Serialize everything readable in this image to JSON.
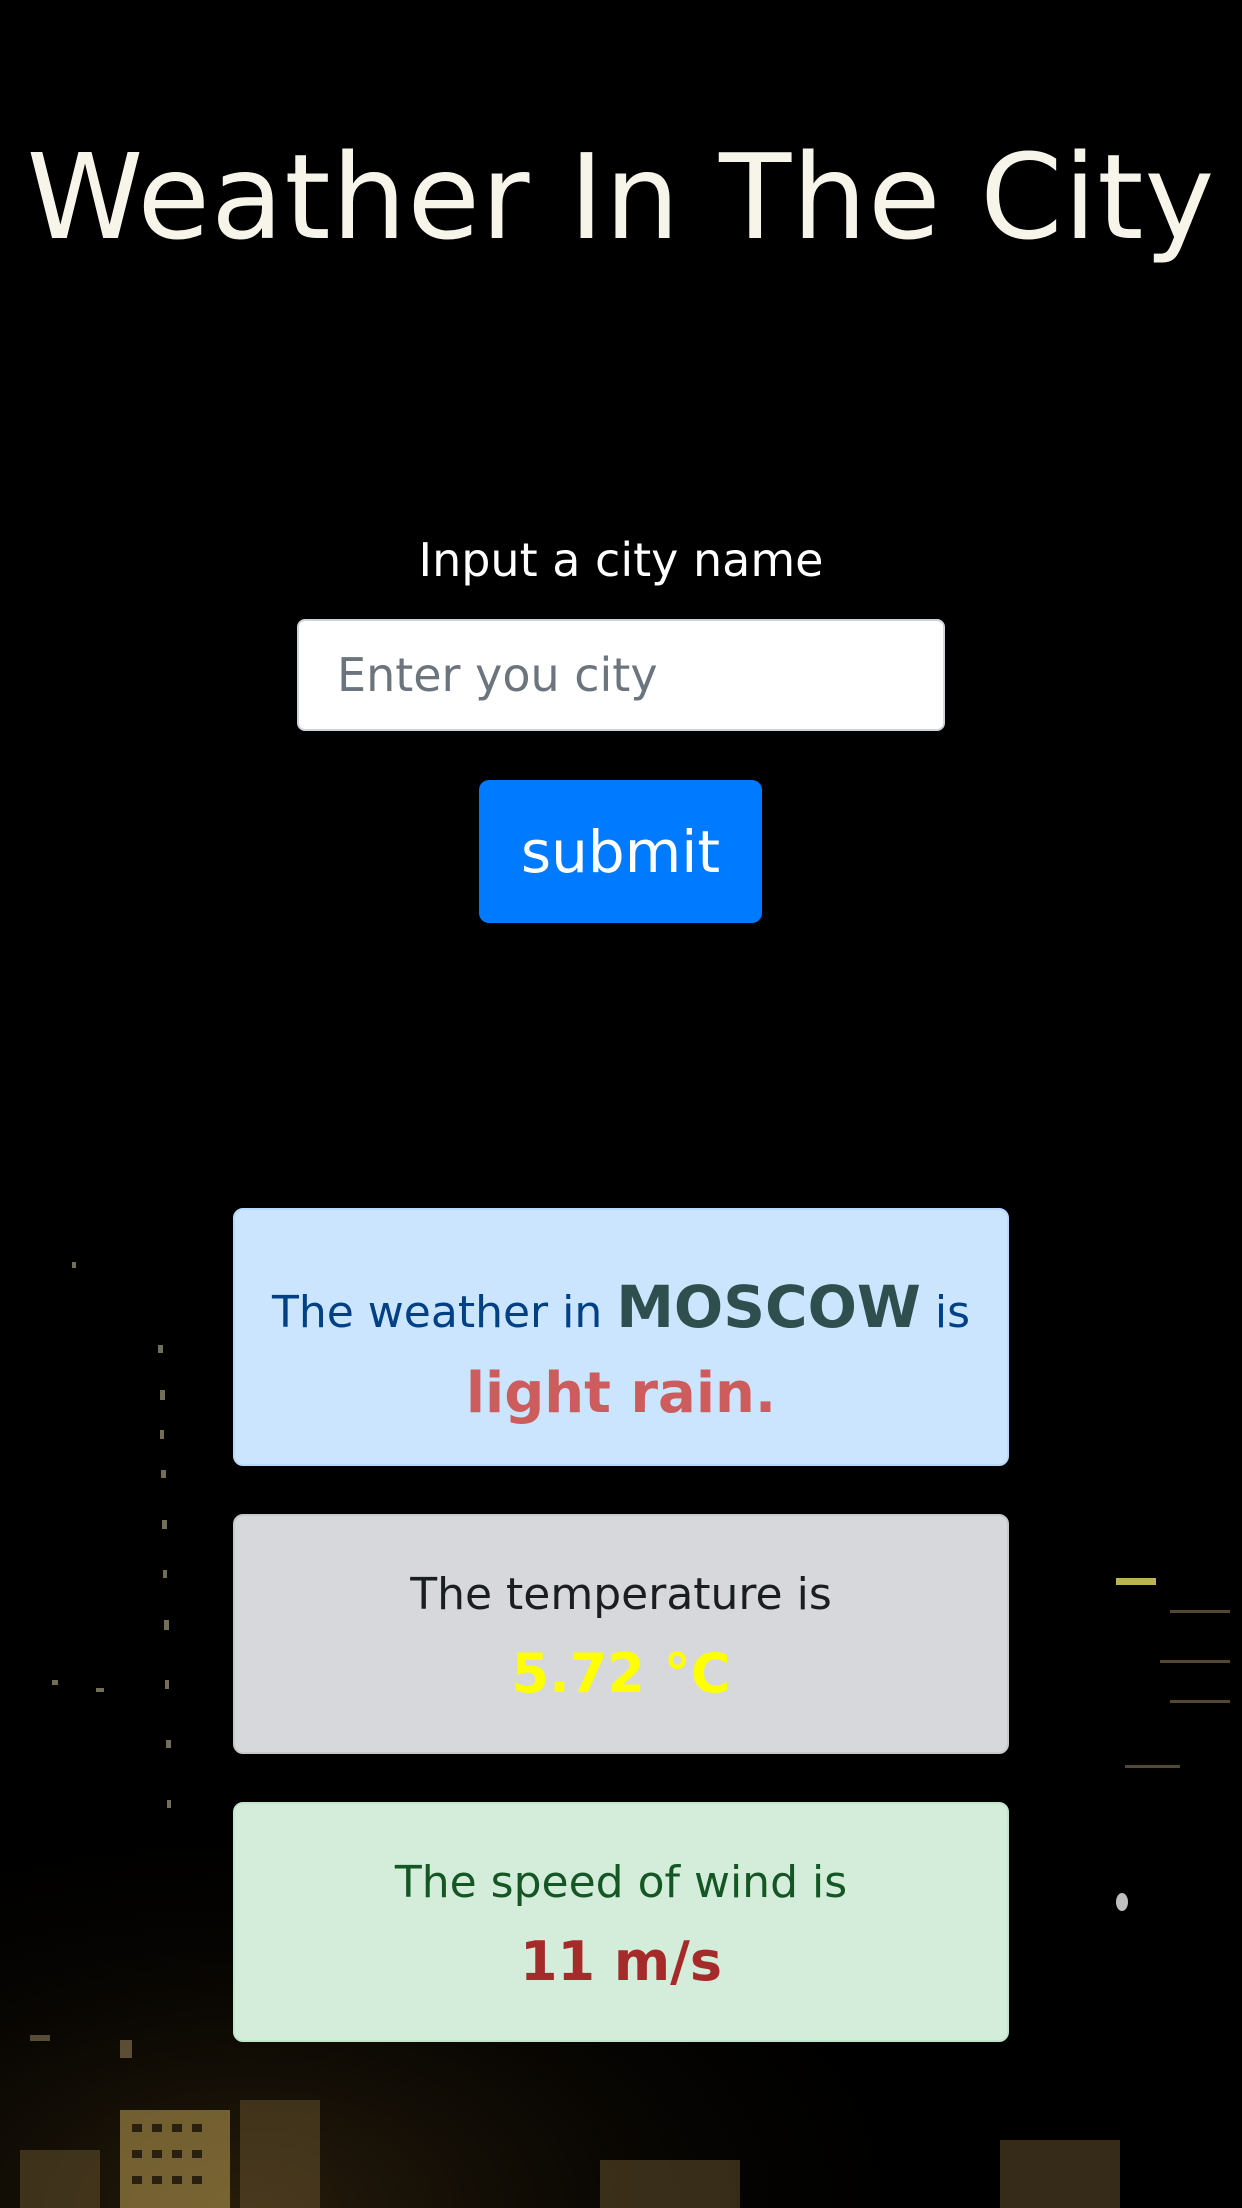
{
  "header": {
    "title": "Weather In The City"
  },
  "form": {
    "label": "Input a city name",
    "input_placeholder": "Enter you city",
    "input_value": "",
    "submit_label": "submit"
  },
  "results": {
    "weather": {
      "prefix": "The weather in ",
      "city": "MOSCOW",
      "suffix": " is",
      "description": "light rain."
    },
    "temperature": {
      "label": "The temperature is",
      "value": "5.72 °C"
    },
    "wind": {
      "label": "The speed of wind is",
      "value": "11 m/s"
    }
  },
  "colors": {
    "background": "#000000",
    "submit_button": "#007bff",
    "weather_card": "#cce5ff",
    "temperature_card": "#d6d8db",
    "wind_card": "#d4edda",
    "weather_description": "#cd5c5c",
    "temperature_value": "#ffff00",
    "wind_value": "#a52a2a"
  }
}
